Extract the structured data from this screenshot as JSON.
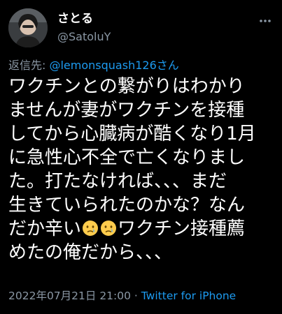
{
  "user": {
    "display_name": "さとる",
    "handle": "@SatoluY"
  },
  "reply": {
    "prefix": "返信先: ",
    "mention": "@lemonsquash126",
    "suffix": "さん"
  },
  "tweet": {
    "lines": [
      "ワクチンとの繋がりはわかり",
      "ませんが妻がワクチンを接種",
      "してから心臓病が酷くなり1月",
      "に急性心不全で亡くなりまし",
      "た。打たなければ、、、まだ",
      "生きていられたのかな？なん"
    ],
    "line7_before": "だか辛い",
    "line7_after": "ワクチン接種薦",
    "line8": "めたの俺だから、、、"
  },
  "meta": {
    "timestamp": "2022年07月21日 21:00",
    "separator": " · ",
    "source": "Twitter for iPhone"
  },
  "icons": {
    "more": "more-dots-icon",
    "emoji": "crying-face-emoji"
  },
  "colors": {
    "background": "#000000",
    "text": "#ffffff",
    "secondary": "#8b98a5",
    "accent": "#1d9bf0"
  }
}
